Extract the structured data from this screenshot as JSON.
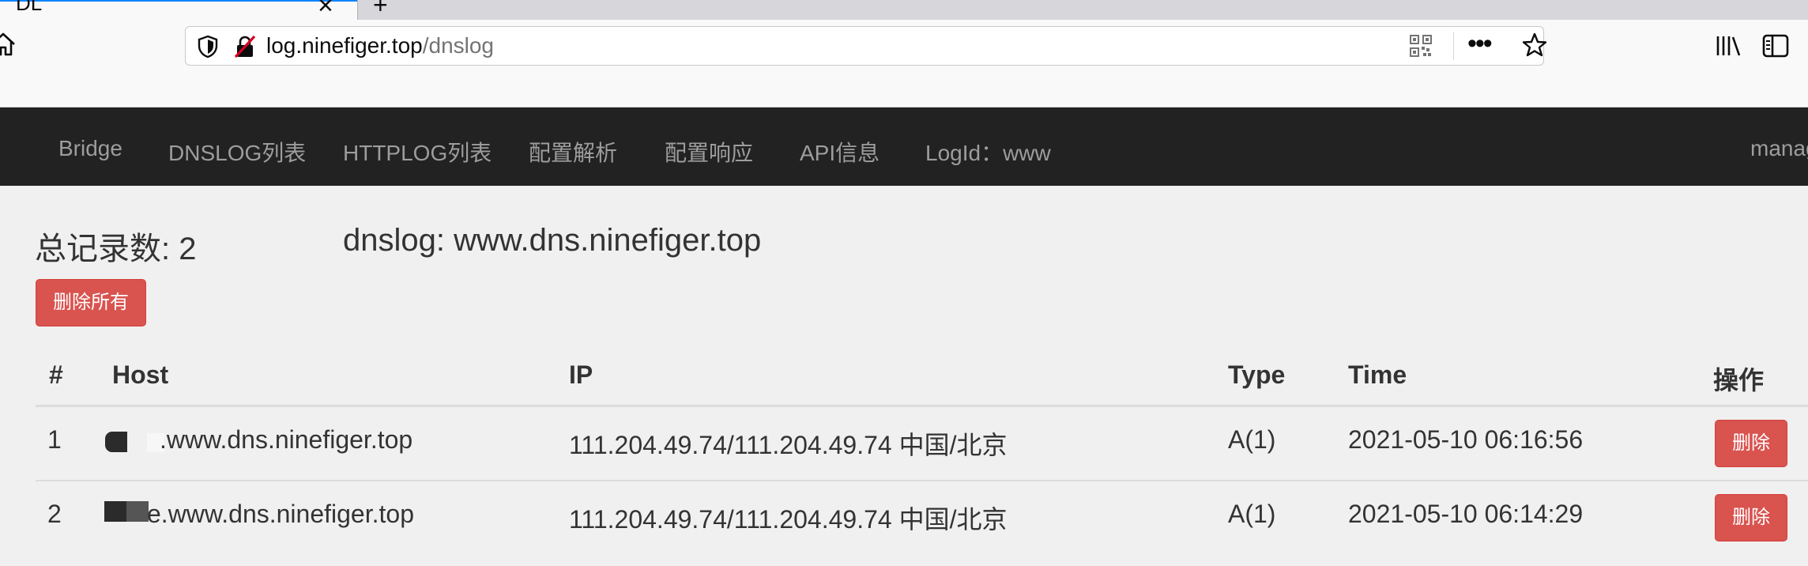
{
  "browser": {
    "tab_title": "DL",
    "tab_close": "×",
    "new_tab": "+",
    "url_domain": "log.ninefiger.top",
    "url_path": "/dnslog",
    "more_label": "•••"
  },
  "nav": {
    "items": [
      "Bridge",
      "DNSLOG列表",
      "HTTPLOG列表",
      "配置解析",
      "配置响应",
      "API信息",
      "LogId：www",
      "manag"
    ]
  },
  "summary": {
    "total": "总记录数: 2",
    "dnslog": "dnslog: www.dns.ninefiger.top",
    "delete_all": "删除所有"
  },
  "table": {
    "columns": [
      "#",
      "Host",
      "IP",
      "Type",
      "Time",
      "操作"
    ],
    "rows": [
      {
        "num": "1",
        "host": ".www.dns.ninefiger.top",
        "ip": "111.204.49.74/111.204.49.74 中国/北京",
        "type": "A(1)",
        "time": "2021-05-10 06:16:56",
        "action": "删除"
      },
      {
        "num": "2",
        "host": "e.www.dns.ninefiger.top",
        "ip": "111.204.49.74/111.204.49.74 中国/北京",
        "type": "A(1)",
        "time": "2021-05-10 06:14:29",
        "action": "删除"
      }
    ]
  },
  "colors": {
    "navbar": "#222222",
    "nav_text": "#9d9d9d",
    "danger": "#d9534f",
    "page_bg": "#f0f0f0"
  }
}
